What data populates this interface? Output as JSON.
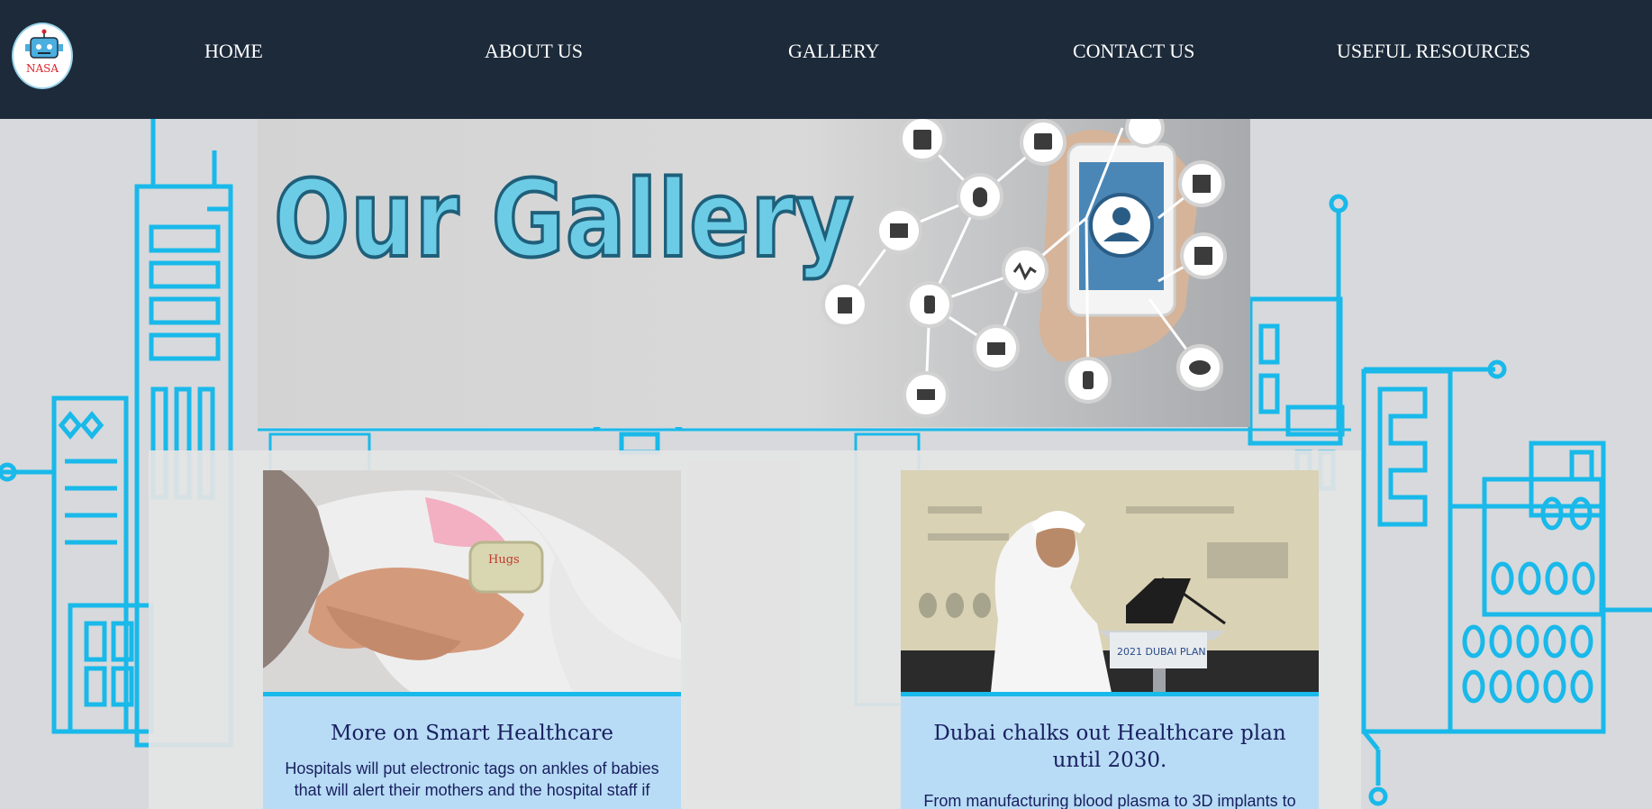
{
  "nav": {
    "logo_text": "NASA",
    "links": [
      {
        "label": "HOME"
      },
      {
        "label": "ABOUT US"
      },
      {
        "label": "GALLERY"
      },
      {
        "label": "CONTACT US"
      },
      {
        "label": "USEFUL RESOURCES"
      }
    ]
  },
  "hero": {
    "title": "Our Gallery"
  },
  "cards": [
    {
      "title": "More on Smart Healthcare",
      "text": "Hospitals will put electronic tags on ankles of babies that will alert their mothers and the hospital staff if",
      "image": "newborn-ankle-tag-photo",
      "tag_text": "Hugs"
    },
    {
      "title": "Dubai chalks out Healthcare plan until 2030.",
      "text": "From manufacturing blood plasma to 3D implants to",
      "image": "speaker-at-podium-photo",
      "podium_text": "2021 DUBAI PLAN"
    }
  ],
  "colors": {
    "nav_bg": "#1c2a3a",
    "line_art": "#19b9ea",
    "card_body": "#b8dcf6",
    "card_title": "#1a2160"
  }
}
